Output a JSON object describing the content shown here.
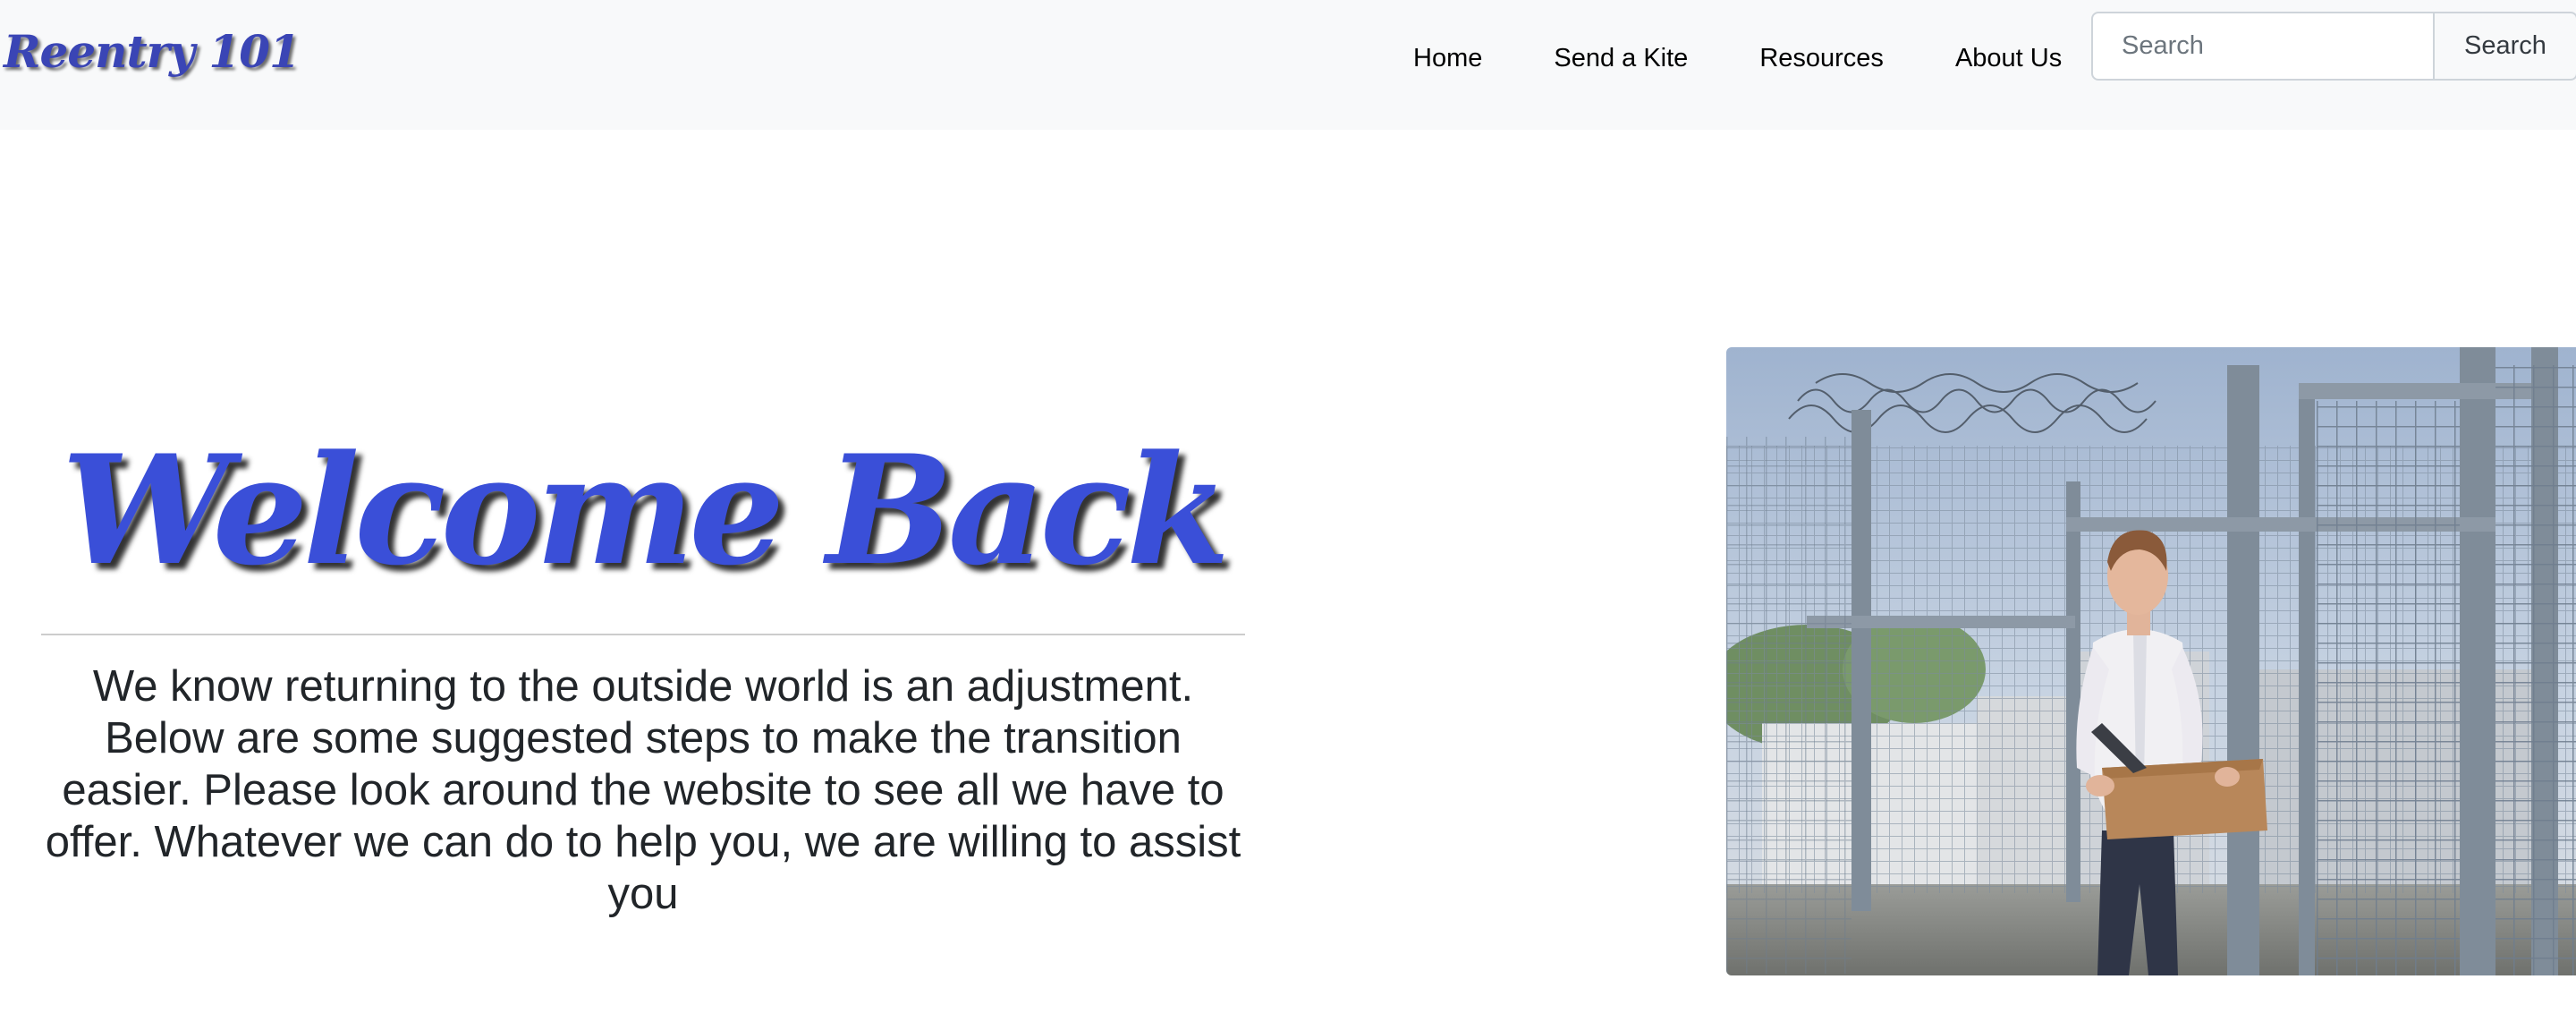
{
  "navbar": {
    "brand": "Reentry 101",
    "links": [
      {
        "label": "Home"
      },
      {
        "label": "Send a Kite"
      },
      {
        "label": "Resources"
      },
      {
        "label": "About Us"
      }
    ],
    "search": {
      "placeholder": "Search",
      "button_label": "Search"
    }
  },
  "hero": {
    "title": "Welcome Back",
    "text": "We know returning to the outside world is an adjustment. Below are some suggested steps to make the transition easier. Please look around the website to see all we have to offer. Whatever we can do to help you, we are willing to assist you"
  },
  "colors": {
    "brand": "#3a45b5",
    "title": "#3a4fd8",
    "navbar_bg": "#f8f9fa"
  }
}
